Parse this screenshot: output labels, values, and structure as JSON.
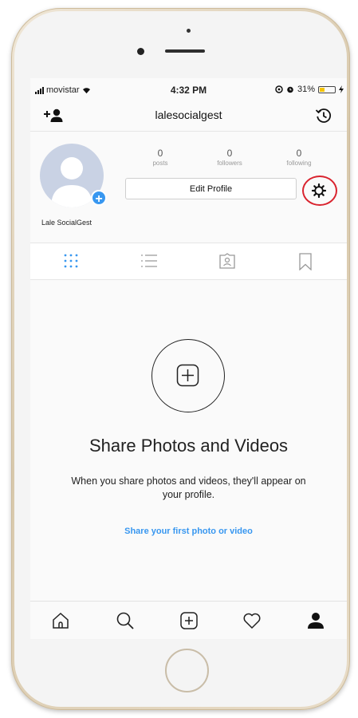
{
  "status_bar": {
    "carrier": "movistar",
    "time": "4:32 PM",
    "battery": "31%",
    "battery_level": 0.31
  },
  "header": {
    "username": "lalesocialgest",
    "add_icon": "add-user-icon",
    "history_icon": "history-icon"
  },
  "profile": {
    "display_name": "Lale SocialGest",
    "stats": [
      {
        "value": "0",
        "label": "posts"
      },
      {
        "value": "0",
        "label": "followers"
      },
      {
        "value": "0",
        "label": "following"
      }
    ],
    "edit_label": "Edit Profile",
    "settings_icon": "gear-icon"
  },
  "tabs": [
    "grid-icon",
    "list-icon",
    "tagged-icon",
    "bookmark-icon"
  ],
  "empty_state": {
    "title": "Share Photos and Videos",
    "text": "When you share photos and videos, they'll appear on your profile.",
    "link": "Share your first photo or video"
  },
  "bottom_nav": [
    "home-icon",
    "search-icon",
    "add-post-icon",
    "heart-icon",
    "profile-icon"
  ],
  "colors": {
    "accent": "#3897f0",
    "highlight": "#d9232e",
    "battery": "#f5c400"
  }
}
